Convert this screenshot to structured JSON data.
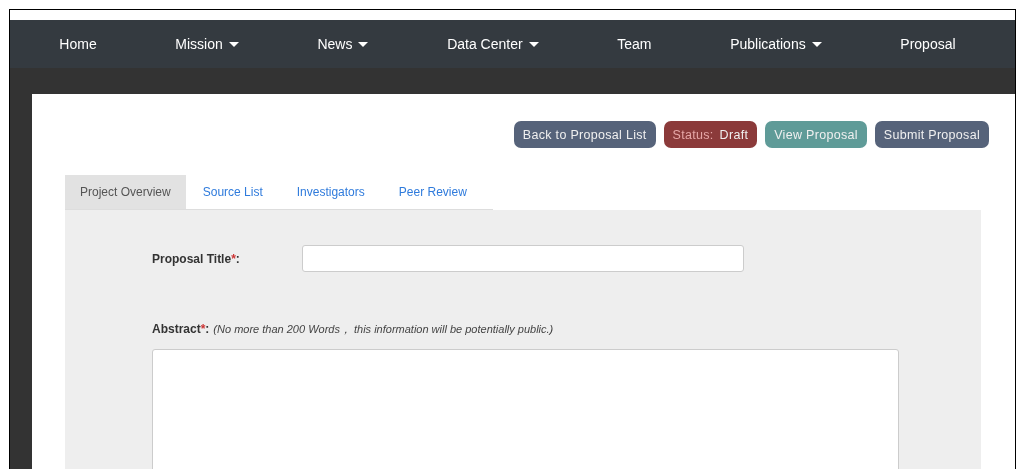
{
  "nav": {
    "items": [
      {
        "label": "Home",
        "dropdown": false
      },
      {
        "label": "Mission",
        "dropdown": true
      },
      {
        "label": "News",
        "dropdown": true
      },
      {
        "label": "Data Center",
        "dropdown": true
      },
      {
        "label": "Team",
        "dropdown": false
      },
      {
        "label": "Publications",
        "dropdown": true
      },
      {
        "label": "Proposal",
        "dropdown": false
      }
    ]
  },
  "actions": [
    {
      "kind": "button",
      "label": "Back to Proposal List",
      "color": "#56637a"
    },
    {
      "kind": "status",
      "label": "Status:",
      "value": "Draft",
      "color": "#8b3a3a"
    },
    {
      "kind": "button",
      "label": "View Proposal",
      "color": "#5f9b98"
    },
    {
      "kind": "button",
      "label": "Submit Proposal",
      "color": "#56637a"
    }
  ],
  "tabs": [
    {
      "label": "Project Overview",
      "selected": true
    },
    {
      "label": "Source List",
      "selected": false
    },
    {
      "label": "Investigators",
      "selected": false
    },
    {
      "label": "Peer Review",
      "selected": false
    }
  ],
  "form": {
    "title_field": {
      "label": "Proposal Title",
      "required_mark": "*",
      "suffix": ":"
    },
    "abstract": {
      "label": "Abstract",
      "required_mark": "*",
      "suffix": ":",
      "note": "(No more than 200 Words， this information will be potentially public.)"
    }
  }
}
